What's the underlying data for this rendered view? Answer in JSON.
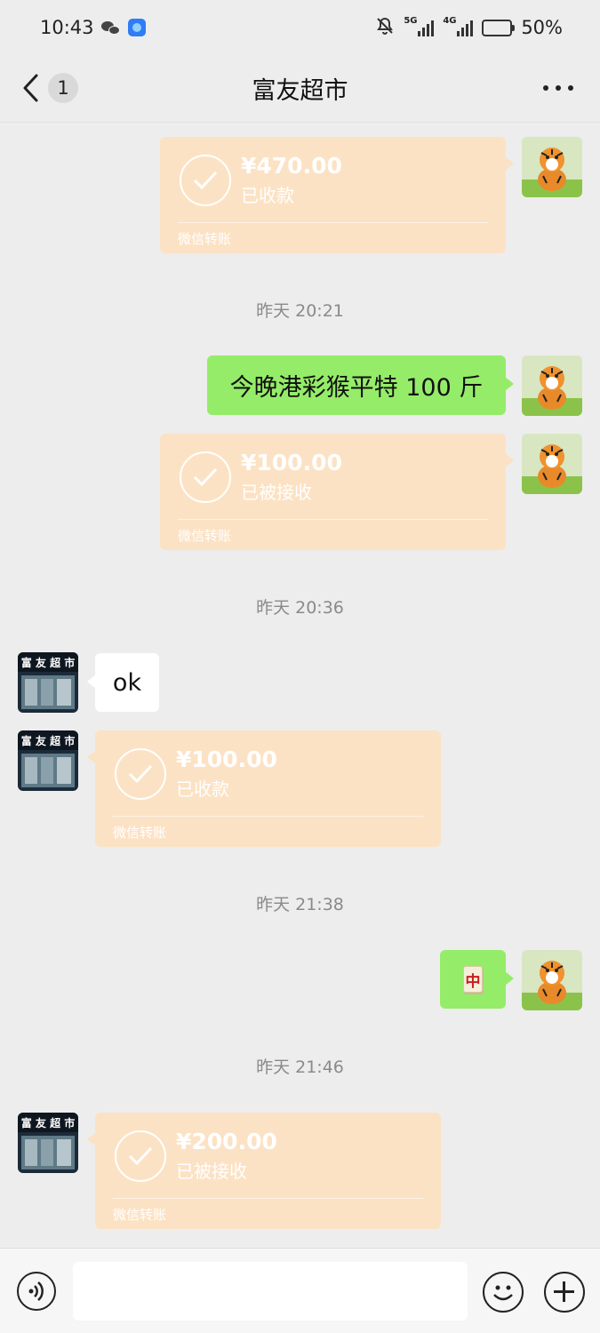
{
  "status_bar": {
    "time": "10:43",
    "network_1": "5G",
    "network_2": "4G",
    "battery_percent": "50%",
    "battery_level": 0.5,
    "icons": [
      "wechat-icon",
      "app-notification-icon",
      "mute-icon",
      "signal-icon",
      "battery-icon"
    ]
  },
  "header": {
    "title": "富友超市",
    "unread_count": "1",
    "back_icon": "chevron-left-icon",
    "more_icon": "more-dots-icon"
  },
  "messages": [
    {
      "type": "transfer",
      "side": "right",
      "amount": "¥470.00",
      "status": "已收款",
      "source": "微信转账"
    },
    {
      "type": "timestamp",
      "text": "昨天 20:21"
    },
    {
      "type": "text",
      "side": "right",
      "text": "今晚港彩猴平特 100 斤"
    },
    {
      "type": "transfer",
      "side": "right",
      "amount": "¥100.00",
      "status": "已被接收",
      "source": "微信转账"
    },
    {
      "type": "timestamp",
      "text": "昨天 20:36"
    },
    {
      "type": "text",
      "side": "left",
      "text": "ok"
    },
    {
      "type": "transfer",
      "side": "left",
      "amount": "¥100.00",
      "status": "已收款",
      "source": "微信转账"
    },
    {
      "type": "timestamp",
      "text": "昨天 21:38"
    },
    {
      "type": "sticker",
      "side": "right",
      "sticker_char": "中"
    },
    {
      "type": "timestamp",
      "text": "昨天 21:46"
    },
    {
      "type": "transfer",
      "side": "left",
      "amount": "¥200.00",
      "status": "已被接收",
      "source": "微信转账"
    }
  ],
  "contact_avatar_text": "富 友 超 市",
  "input_bar": {
    "placeholder": "",
    "icons": [
      "voice-icon",
      "emoji-icon",
      "plus-icon"
    ]
  },
  "colors": {
    "background": "#ededed",
    "transfer_bubble": "#fce2c4",
    "sent_bubble": "#95ec69",
    "received_bubble": "#ffffff"
  }
}
